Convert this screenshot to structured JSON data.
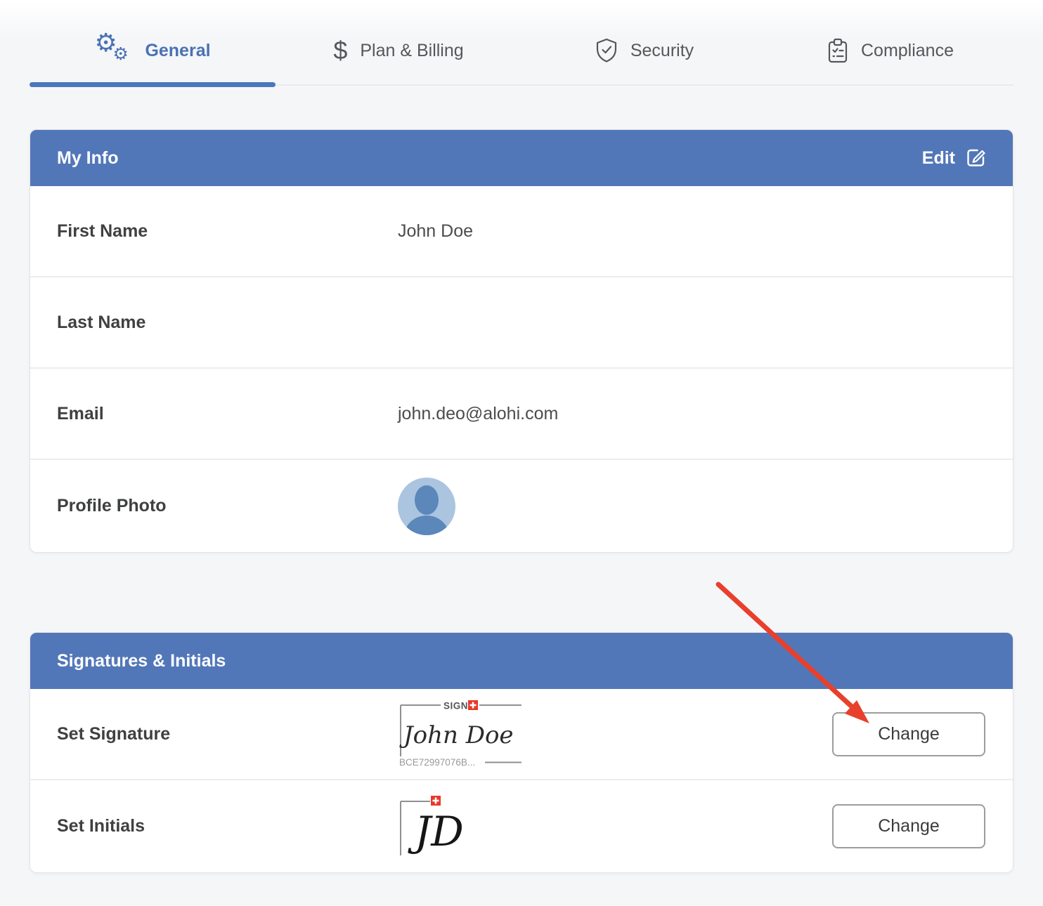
{
  "tabs": [
    {
      "label": "General",
      "icon": "gears-icon",
      "active": true
    },
    {
      "label": "Plan & Billing",
      "icon": "dollar-icon",
      "active": false
    },
    {
      "label": "Security",
      "icon": "shield-check-icon",
      "active": false
    },
    {
      "label": "Compliance",
      "icon": "clipboard-check-icon",
      "active": false
    }
  ],
  "my_info": {
    "title": "My Info",
    "edit_label": "Edit",
    "fields": [
      {
        "label": "First Name",
        "value": "John Doe"
      },
      {
        "label": "Last Name",
        "value": ""
      },
      {
        "label": "Email",
        "value": "john.deo@alohi.com"
      },
      {
        "label": "Profile Photo",
        "value": ""
      }
    ]
  },
  "signatures": {
    "title": "Signatures & Initials",
    "signature_row": {
      "label": "Set Signature",
      "button_label": "Change"
    },
    "initials_row": {
      "label": "Set Initials",
      "button_label": "Change"
    },
    "signature": {
      "sign_label": "SIGN",
      "name_script": "John Doe",
      "cert_id": "BCE72997076B..."
    },
    "initials": {
      "script": "JD"
    }
  },
  "colors": {
    "header_blue": "#5277b8",
    "accent_blue": "#4a72b4",
    "tab_underline_blue": "#4a77bd",
    "arrow_red": "#e8402d",
    "flag_red": "#e8392a",
    "avatar_bg": "#abc4df",
    "avatar_fg": "#5b87ba"
  }
}
